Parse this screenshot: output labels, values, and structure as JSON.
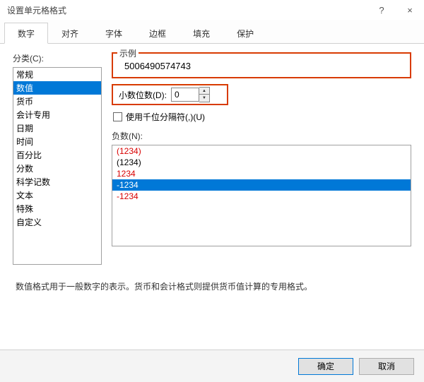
{
  "titlebar": {
    "title": "设置单元格格式",
    "help": "?",
    "close": "×"
  },
  "tabs": {
    "items": [
      {
        "label": "数字"
      },
      {
        "label": "对齐"
      },
      {
        "label": "字体"
      },
      {
        "label": "边框"
      },
      {
        "label": "填充"
      },
      {
        "label": "保护"
      }
    ],
    "active_index": 0
  },
  "category": {
    "label": "分类(C):",
    "items": [
      {
        "label": "常规"
      },
      {
        "label": "数值"
      },
      {
        "label": "货币"
      },
      {
        "label": "会计专用"
      },
      {
        "label": "日期"
      },
      {
        "label": "时间"
      },
      {
        "label": "百分比"
      },
      {
        "label": "分数"
      },
      {
        "label": "科学记数"
      },
      {
        "label": "文本"
      },
      {
        "label": "特殊"
      },
      {
        "label": "自定义"
      }
    ],
    "selected_index": 1
  },
  "sample": {
    "legend": "示例",
    "value": "5006490574743"
  },
  "decimals": {
    "label": "小数位数(D):",
    "value": "0"
  },
  "thousands": {
    "label": "使用千位分隔符(,)(U)",
    "checked": false
  },
  "negatives": {
    "label": "负数(N):",
    "items": [
      {
        "label": "(1234)",
        "red": true
      },
      {
        "label": "(1234)",
        "red": false
      },
      {
        "label": "1234",
        "red": true
      },
      {
        "label": "-1234",
        "red": false
      },
      {
        "label": "-1234",
        "red": true
      }
    ],
    "selected_index": 3
  },
  "hint": "数值格式用于一般数字的表示。货币和会计格式则提供货币值计算的专用格式。",
  "footer": {
    "ok": "确定",
    "cancel": "取消"
  }
}
